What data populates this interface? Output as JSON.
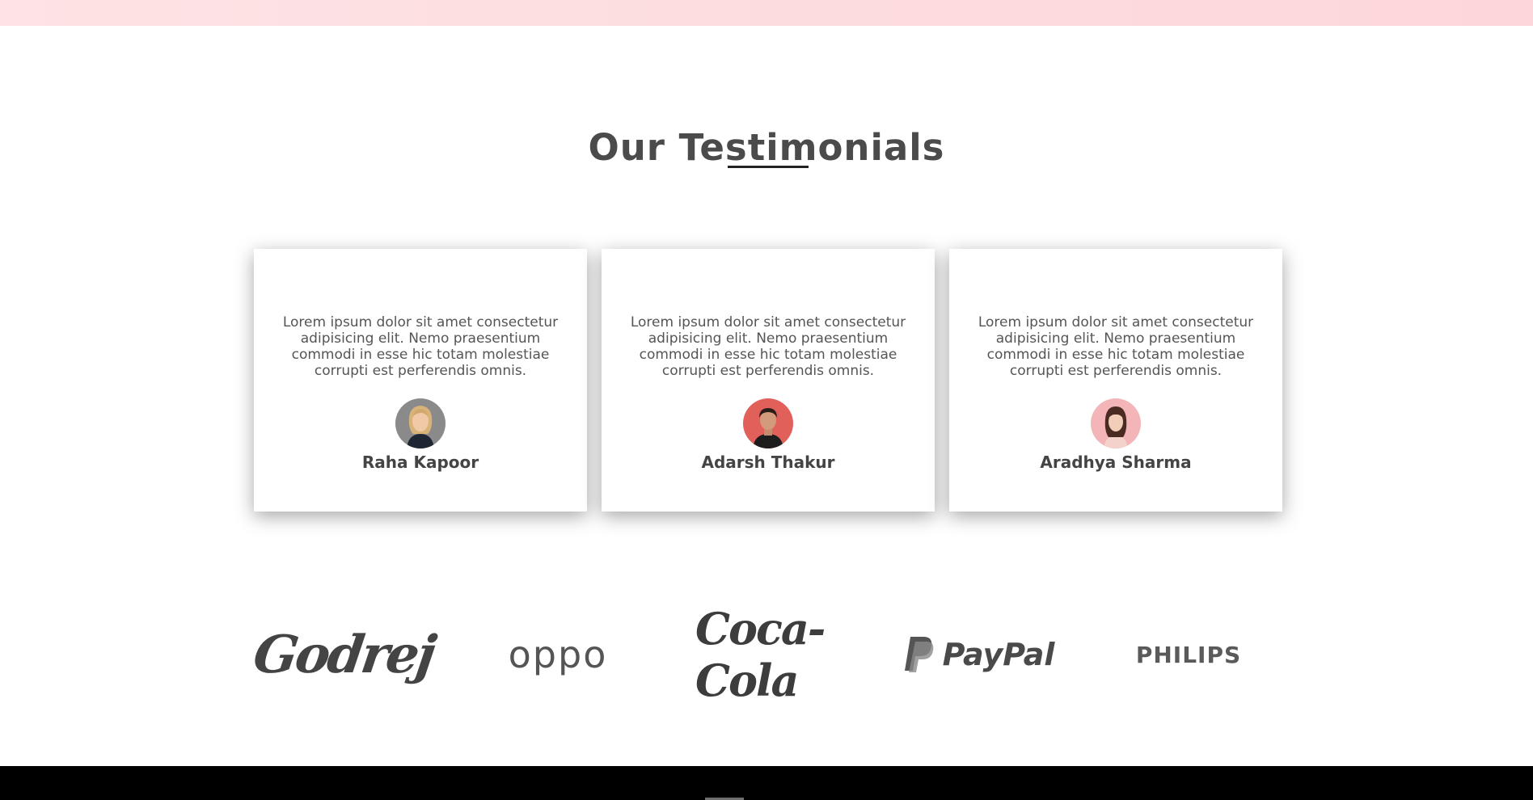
{
  "section": {
    "title": "Our Testimonials"
  },
  "testimonials": [
    {
      "quote": "Lorem ipsum dolor sit amet consectetur adipisicing elit. Nemo praesentium commodi in esse hic totam molestiae corrupti est perferendis omnis.",
      "name": "Raha Kapoor"
    },
    {
      "quote": "Lorem ipsum dolor sit amet consectetur adipisicing elit. Nemo praesentium commodi in esse hic totam molestiae corrupti est perferendis omnis.",
      "name": "Adarsh Thakur"
    },
    {
      "quote": "Lorem ipsum dolor sit amet consectetur adipisicing elit. Nemo praesentium commodi in esse hic totam molestiae corrupti est perferendis omnis.",
      "name": "Aradhya Sharma"
    }
  ],
  "brands": [
    {
      "name": "Godrej",
      "icon": "godrej-logo"
    },
    {
      "name": "oppo",
      "icon": "oppo-logo"
    },
    {
      "name": "Coca-Cola",
      "icon": "coca-cola-logo"
    },
    {
      "name": "PayPal",
      "icon": "paypal-logo"
    },
    {
      "name": "PHILIPS",
      "icon": "philips-logo"
    }
  ],
  "colors": {
    "top_band": "#fde3e5",
    "heading": "#4b4b4b",
    "footer": "#000000"
  }
}
